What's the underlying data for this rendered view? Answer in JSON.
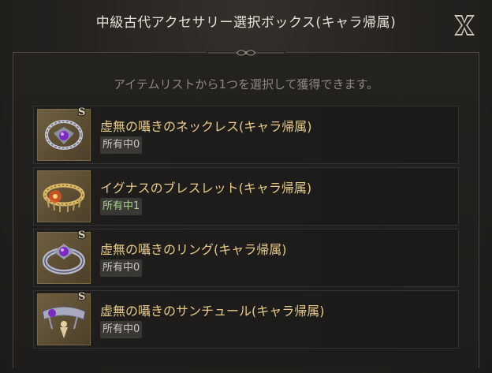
{
  "dialog": {
    "title": "中級古代アクセサリー選択ボックス(キャラ帰属)",
    "subtitle": "アイテムリストから1つを選択して獲得できます。",
    "close_icon": "x-close-icon"
  },
  "items": [
    {
      "grade": "S",
      "name": "虚無の囁きのネックレス(キャラ帰属)",
      "owned": "所有中0",
      "icon": "necklace-icon",
      "gem_color": "#7b2bbf"
    },
    {
      "grade": "",
      "name": "イグナスのブレスレット(キャラ帰属)",
      "owned": "所有中1",
      "icon": "bracelet-icon",
      "gem_color": "#d9541f"
    },
    {
      "grade": "S",
      "name": "虚無の囁きのリング(キャラ帰属)",
      "owned": "所有中0",
      "icon": "ring-icon",
      "gem_color": "#7b2bbf"
    },
    {
      "grade": "S",
      "name": "虚無の囁きのサンチュール(キャラ帰属)",
      "owned": "所有中0",
      "icon": "belt-icon",
      "gem_color": "#7b2bbf"
    }
  ]
}
